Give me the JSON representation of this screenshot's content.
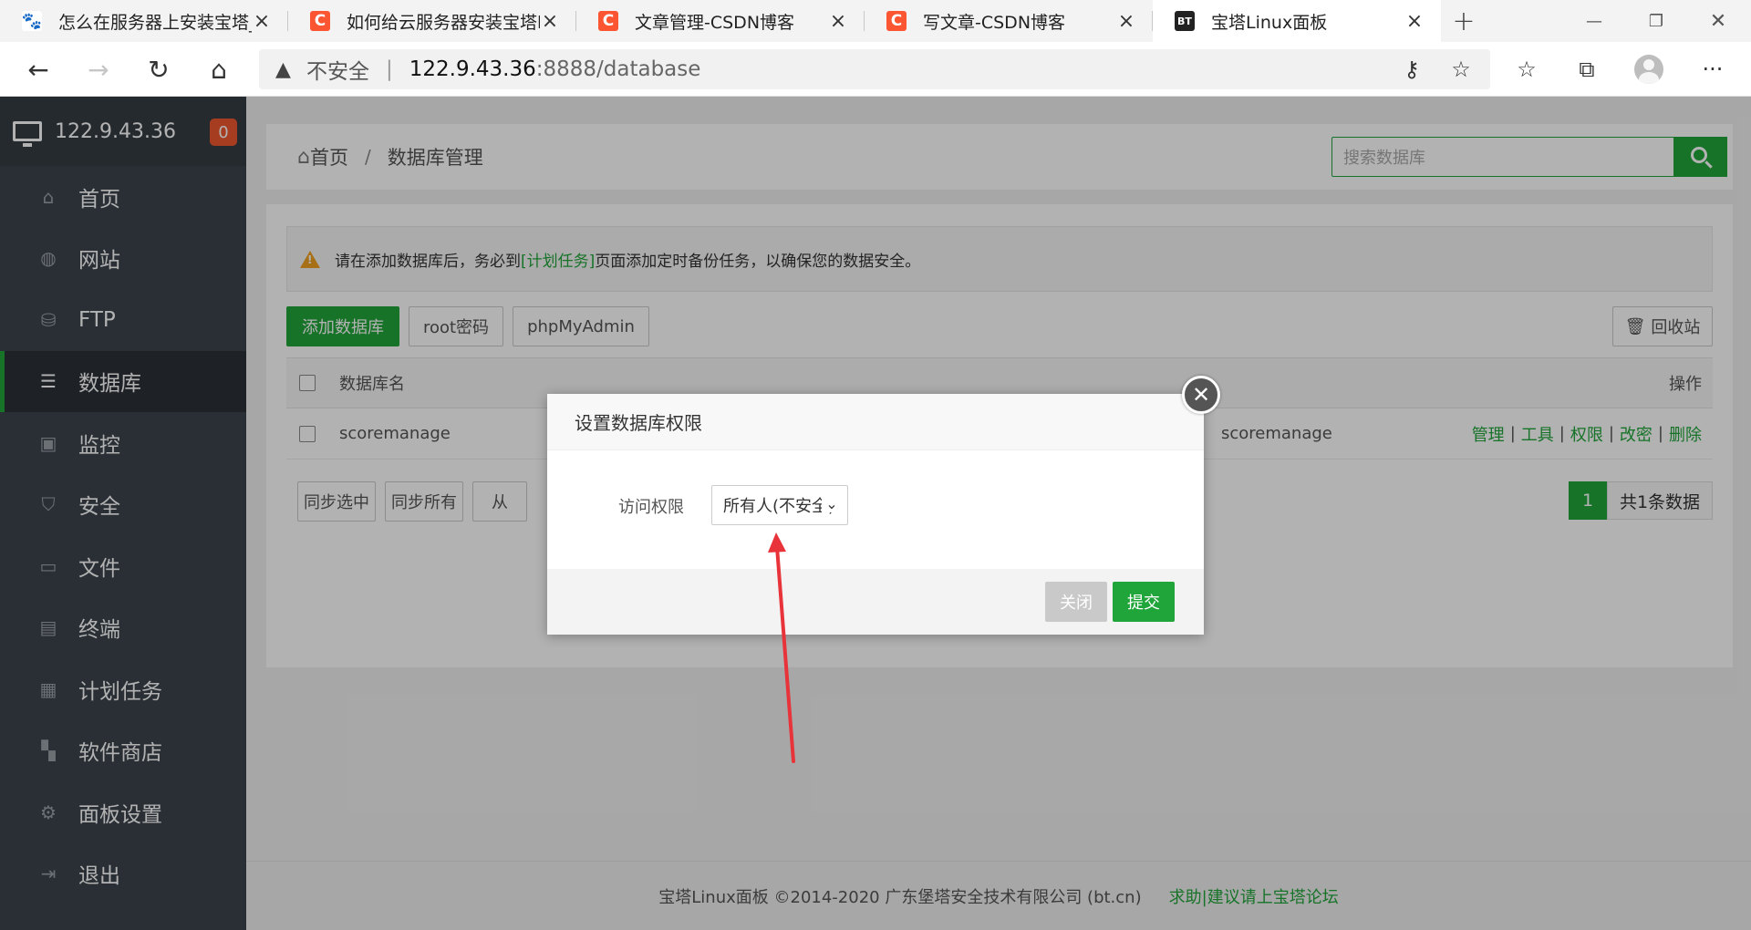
{
  "browser": {
    "tabs": [
      {
        "title": "怎么在服务器上安装宝塔_百",
        "icon": "baidu-icon",
        "active": false
      },
      {
        "title": "如何给云服务器安装宝塔lin",
        "icon": "csdn-icon",
        "active": false
      },
      {
        "title": "文章管理-CSDN博客",
        "icon": "csdn-icon",
        "active": false
      },
      {
        "title": "写文章-CSDN博客",
        "icon": "csdn-icon",
        "active": false
      },
      {
        "title": "宝塔Linux面板",
        "icon": "bt-icon",
        "active": true
      }
    ],
    "url": {
      "security_label": "不安全",
      "host": "122.9.43.36",
      "path": ":8888/database"
    }
  },
  "sidebar": {
    "server_ip": "122.9.43.36",
    "badge_count": "0",
    "items": [
      {
        "label": "首页",
        "icon": "home-icon"
      },
      {
        "label": "网站",
        "icon": "globe-icon"
      },
      {
        "label": "FTP",
        "icon": "ftp-icon"
      },
      {
        "label": "数据库",
        "icon": "database-icon",
        "active": true
      },
      {
        "label": "监控",
        "icon": "monitor-icon"
      },
      {
        "label": "安全",
        "icon": "shield-icon"
      },
      {
        "label": "文件",
        "icon": "folder-icon"
      },
      {
        "label": "终端",
        "icon": "terminal-icon"
      },
      {
        "label": "计划任务",
        "icon": "calendar-icon"
      },
      {
        "label": "软件商店",
        "icon": "apps-icon"
      },
      {
        "label": "面板设置",
        "icon": "gear-icon"
      },
      {
        "label": "退出",
        "icon": "logout-icon"
      }
    ]
  },
  "breadcrumb": {
    "home": "首页",
    "current": "数据库管理"
  },
  "search": {
    "placeholder": "搜索数据库"
  },
  "notice": {
    "before": "请在添加数据库后，务必到",
    "link": "[计划任务]",
    "after": "页面添加定时备份任务，以确保您的数据安全。"
  },
  "toolbar": {
    "add_db": "添加数据库",
    "root_pwd": "root密码",
    "phpmyadmin": "phpMyAdmin",
    "recycle": "回收站"
  },
  "table": {
    "headers": {
      "name": "数据库名",
      "ops": "操作"
    },
    "rows": [
      {
        "name": "scoremanage",
        "note": "scoremanage",
        "ops": [
          "管理",
          "工具",
          "权限",
          "改密",
          "删除"
        ]
      }
    ]
  },
  "bottom_buttons": {
    "sync_selected": "同步选中",
    "sync_all": "同步所有",
    "from_server": "从"
  },
  "pager": {
    "current": "1",
    "total_text": "共1条数据"
  },
  "footer": {
    "copyright": "宝塔Linux面板 ©2014-2020 广东堡塔安全技术有限公司 (bt.cn)",
    "link": "求助|建议请上宝塔论坛"
  },
  "modal": {
    "title": "设置数据库权限",
    "field_label": "访问权限",
    "select_value": "所有人(不安全)",
    "close_label": "关闭",
    "submit_label": "提交"
  },
  "colors": {
    "accent": "#20a53a",
    "sidebar_bg": "#3c444d",
    "badge": "#f0582e",
    "annotation_arrow": "#e8333a"
  }
}
